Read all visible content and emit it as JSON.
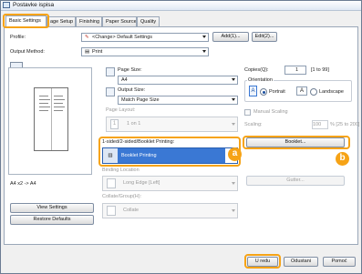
{
  "window": {
    "title": "Postavke ispisa"
  },
  "tabs": [
    "Basic Settings",
    "age Setup",
    "Finishing",
    "Paper Source",
    "Quality"
  ],
  "profile": {
    "label": "Profile:",
    "value": "<Change> Default Settings",
    "add_label": "Add(1)...",
    "edit_label": "Edit(2)..."
  },
  "output_method": {
    "label": "Output Method:",
    "value": "Print"
  },
  "preview": {
    "caption": "A4 x2 -> A4"
  },
  "page_size": {
    "label": "Page Size:",
    "value": "A4"
  },
  "output_size": {
    "label": "Output Size:",
    "value": "Match Page Size"
  },
  "page_layout": {
    "label": "Page Layout:",
    "value": "1 on 1"
  },
  "copies": {
    "label": "Copies(Q):",
    "value": "1",
    "range": "[1 to 99]"
  },
  "orientation": {
    "label": "Orientation",
    "portrait": "Portrait",
    "landscape": "Landscape",
    "selected": "Portrait"
  },
  "manual_scaling": {
    "label": "Manual Scaling"
  },
  "scaling": {
    "label": "Scaling:",
    "value": "100",
    "range": "% [25 to 200]"
  },
  "printing_mode": {
    "label": "1-sided/2-sided/Booklet Printing:",
    "value": "Booklet Printing"
  },
  "booklet_button": {
    "label": "Booklet..."
  },
  "binding_location": {
    "label": "Binding Location",
    "value": "Long Edge [Left]"
  },
  "gutter_button": {
    "label": "Gutter..."
  },
  "collate": {
    "label": "Collate/Group(H):",
    "value": "Collate"
  },
  "view_settings": {
    "label": "View Settings"
  },
  "restore_defaults": {
    "label": "Restore Defaults"
  },
  "footer": {
    "ok": "U redu",
    "cancel": "Odustani",
    "help": "Pomoć"
  },
  "callouts": {
    "a": "a",
    "b": "b"
  },
  "colors": {
    "highlight": "#f6a316",
    "selected": "#3a78d4"
  }
}
